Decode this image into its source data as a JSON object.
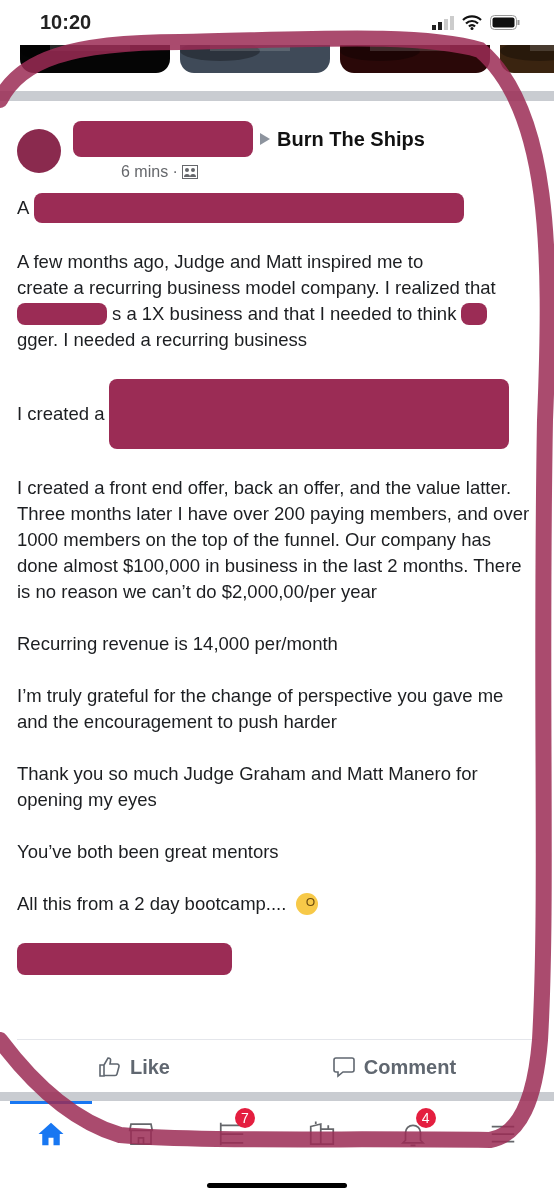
{
  "status_bar": {
    "time": "10:20"
  },
  "post": {
    "group": "Burn The Ships",
    "time": "6 mins ·",
    "paragraphs": [
      [
        {
          "kind": "text",
          "text": "A"
        },
        {
          "kind": "redacted"
        }
      ],
      [
        {
          "kind": "text",
          "text": "A few months ago, Judge and Matt inspired me to"
        },
        {
          "kind": "text",
          "text": "create a recurring business model company. I realized"
        },
        {
          "kind": "text",
          "text": "that"
        },
        {
          "kind": "redacted"
        },
        {
          "kind": "text",
          "text": "s a 1X business and that I needed to"
        },
        {
          "kind": "text",
          "text": "think"
        },
        {
          "kind": "redacted"
        },
        {
          "kind": "text",
          "text": "gger. I needed a recurring business"
        }
      ],
      [
        {
          "kind": "text",
          "text": "I created a"
        },
        {
          "kind": "redacted"
        }
      ],
      [
        {
          "kind": "text",
          "text": "I created a front end offer, back an offer, and the value latter. Three months later I have over 200 paying members, and over 1000 members on the top of the funnel. Our company has done almost $100,000 in business in the last 2 months. There is no reason we can’t do $2,000,00/per year"
        }
      ],
      [
        {
          "kind": "text",
          "text": "Recurring revenue is 14,000 per/month"
        }
      ],
      [
        {
          "kind": "text",
          "text": "I’m truly grateful for the change of perspective you gave me and the encouragement to push harder"
        }
      ],
      [
        {
          "kind": "text",
          "text": "Thank you so much Judge Graham and Matt Manero for opening my eyes"
        }
      ],
      [
        {
          "kind": "text",
          "text": "You’ve both been great mentors"
        }
      ],
      [
        {
          "kind": "text",
          "text": "All this from a 2 day bootcamp...."
        },
        {
          "kind": "emoji"
        }
      ],
      [
        {
          "kind": "redacted"
        }
      ]
    ],
    "actions": [
      {
        "kind": "like",
        "label": "Like"
      },
      {
        "kind": "comment",
        "label": "Comment"
      }
    ]
  },
  "tab_bar": [
    {
      "kind": "home",
      "selected": true
    },
    {
      "kind": "store",
      "selected": false
    },
    {
      "kind": "feed",
      "selected": false,
      "badge": "7"
    },
    {
      "kind": "pages",
      "selected": false
    },
    {
      "kind": "bell",
      "selected": false,
      "badge": "4"
    },
    {
      "kind": "menu",
      "selected": false
    }
  ]
}
